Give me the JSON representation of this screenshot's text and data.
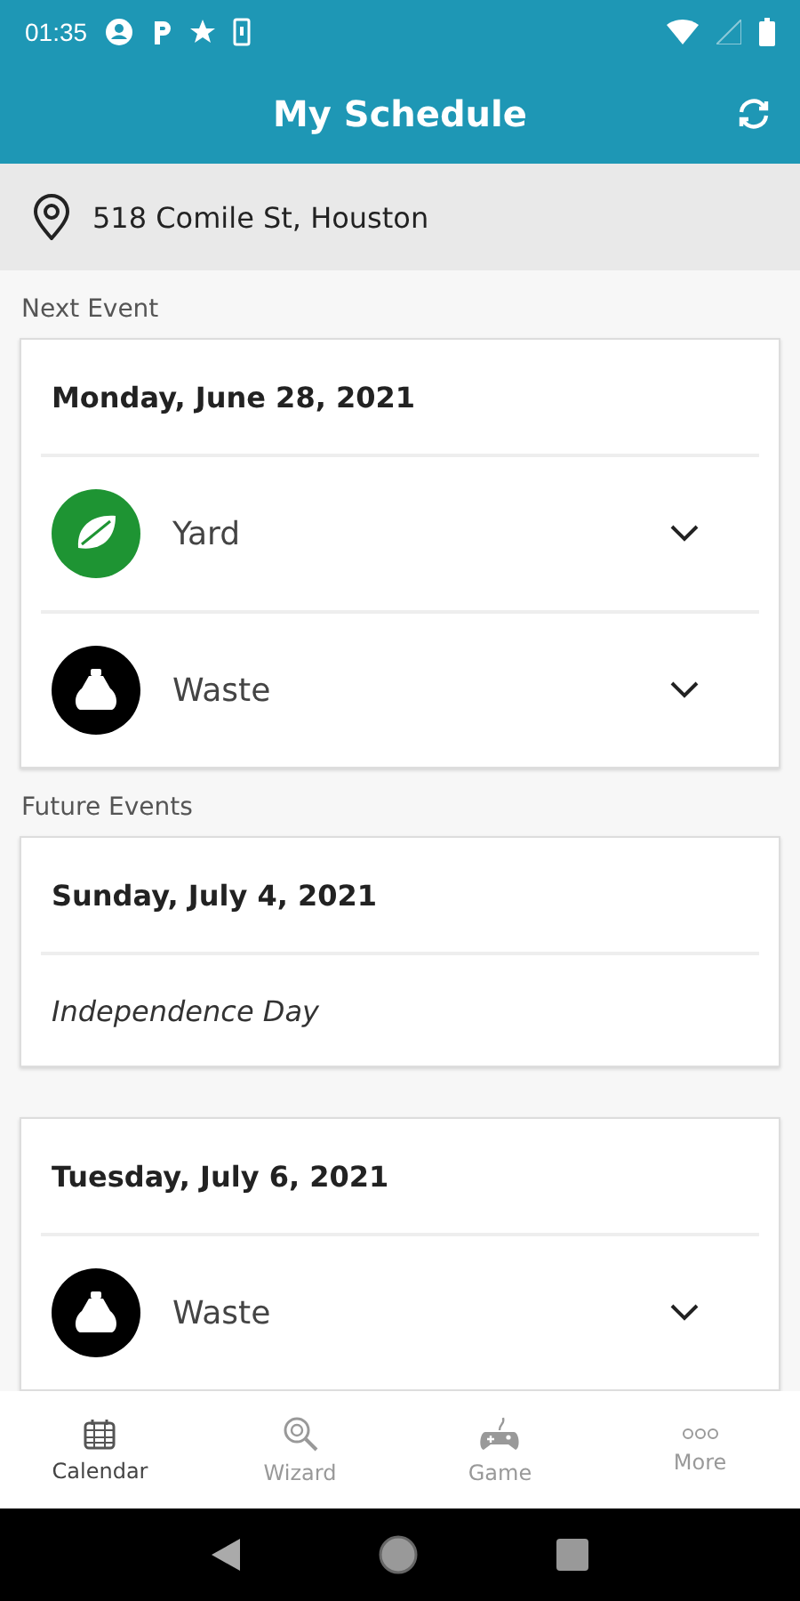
{
  "status_bar": {
    "time": "01:35"
  },
  "app_bar": {
    "title": "My Schedule"
  },
  "address": "518 Comile St, Houston",
  "sections": [
    {
      "label": "Next Event",
      "cards": [
        {
          "date": "Monday, June 28, 2021",
          "items": [
            {
              "kind": "yard",
              "label": "Yard",
              "color": "#1e9433"
            },
            {
              "kind": "waste",
              "label": "Waste",
              "color": "#000000"
            }
          ]
        }
      ]
    },
    {
      "label": "Future Events",
      "cards": [
        {
          "date": "Sunday, July 4, 2021",
          "items": [
            {
              "kind": "holiday",
              "label": "Independence Day"
            }
          ]
        },
        {
          "date": "Tuesday, July 6, 2021",
          "items": [
            {
              "kind": "waste",
              "label": "Waste",
              "color": "#000000"
            }
          ]
        }
      ]
    }
  ],
  "bottom_nav": [
    {
      "kind": "calendar",
      "label": "Calendar",
      "selected": true
    },
    {
      "kind": "wizard",
      "label": "Wizard",
      "selected": false
    },
    {
      "kind": "game",
      "label": "Game",
      "selected": false
    },
    {
      "kind": "more",
      "label": "More",
      "selected": false
    }
  ]
}
